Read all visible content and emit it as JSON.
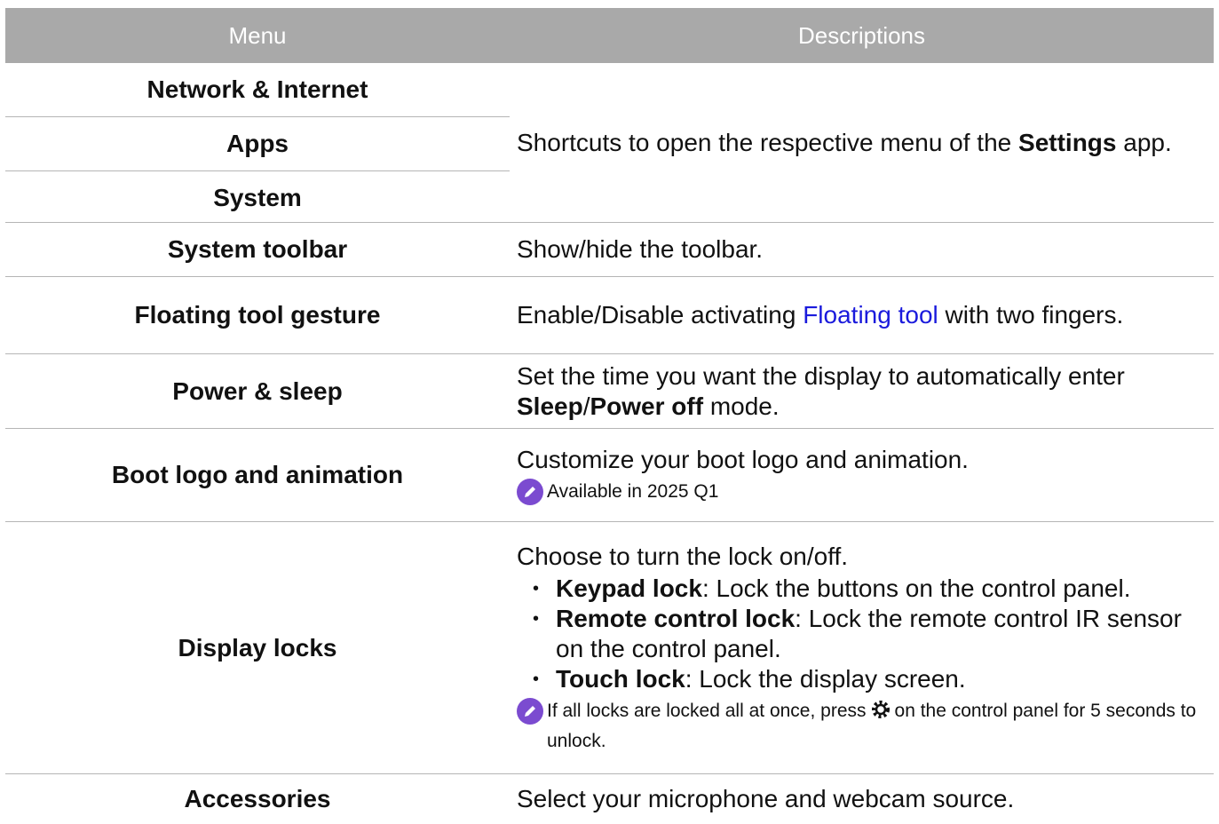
{
  "header": {
    "col1": "Menu",
    "col2": "Descriptions"
  },
  "settings_group": {
    "items": [
      "Network & Internet",
      "Apps",
      "System"
    ],
    "desc_prefix": "Shortcuts to open the respective menu of the ",
    "desc_bold": "Settings",
    "desc_suffix": " app."
  },
  "system_toolbar": {
    "menu": "System toolbar",
    "desc": "Show/hide the toolbar."
  },
  "floating_gesture": {
    "menu": "Floating tool gesture",
    "desc_prefix": "Enable/Disable activating ",
    "link": "Floating tool",
    "desc_suffix": " with two fingers."
  },
  "power_sleep": {
    "menu": "Power & sleep",
    "desc_prefix": "Set the time you want the display to automatically enter ",
    "bold1": "Sleep",
    "slash": "/",
    "bold2": "Power off",
    "desc_suffix": " mode."
  },
  "boot_logo": {
    "menu": "Boot logo and animation",
    "desc": "Customize your boot logo and animation.",
    "note": "Available in 2025 Q1"
  },
  "display_locks": {
    "menu": "Display locks",
    "intro": "Choose to turn the lock on/off.",
    "items": [
      {
        "name": "Keypad lock",
        "text": ": Lock the buttons on the control panel."
      },
      {
        "name": "Remote control lock",
        "text": ": Lock the remote control IR sensor on the control panel."
      },
      {
        "name": "Touch lock",
        "text": ": Lock the display screen."
      }
    ],
    "note_prefix": "If all locks are locked all at once, press",
    "note_suffix": "on the control panel for 5 seconds to unlock."
  },
  "accessories": {
    "menu": "Accessories",
    "desc": "Select your microphone and webcam source."
  },
  "icons": {
    "note": "pencil-note-icon",
    "gear": "gear-icon"
  },
  "colors": {
    "header_bg": "#a9a9a9",
    "link": "#1a1adc",
    "note_icon": "#7b4bd0"
  }
}
